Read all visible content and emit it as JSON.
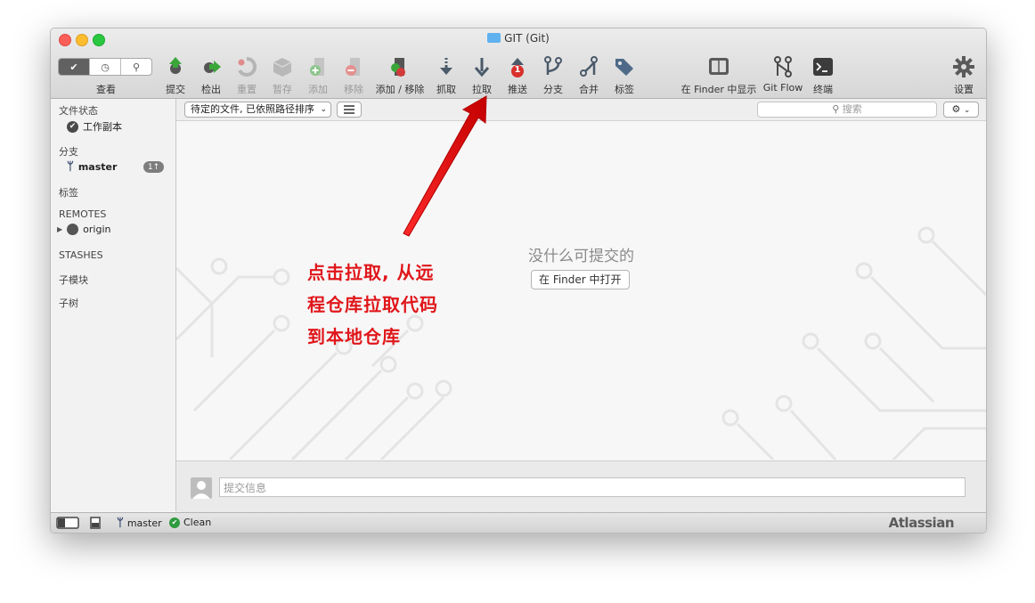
{
  "window": {
    "title": "GIT (Git)"
  },
  "view_label": "查看",
  "toolbar": {
    "commit": "提交",
    "checkout": "检出",
    "reset": "重置",
    "stash": "暂存",
    "add": "添加",
    "remove": "移除",
    "add_remove": "添加 / 移除",
    "fetch": "抓取",
    "pull": "拉取",
    "push": "推送",
    "branch": "分支",
    "merge": "合并",
    "tag": "标签",
    "show_in_finder": "在 Finder 中显示",
    "git_flow": "Git Flow",
    "terminal": "终端",
    "settings": "设置",
    "push_badge": "1"
  },
  "sidebar": {
    "file_status": "文件状态",
    "working_copy": "工作副本",
    "branches": "分支",
    "master": "master",
    "master_badge": "1↑",
    "tags": "标签",
    "remotes": "REMOTES",
    "origin": "origin",
    "stashes": "STASHES",
    "submodules": "子模块",
    "subtrees": "子树"
  },
  "filter": {
    "sort": "待定的文件, 已依照路径排序",
    "search_placeholder": "搜索"
  },
  "main": {
    "empty_message": "没什么可提交的",
    "open_in_finder": "在 Finder 中打开"
  },
  "commit": {
    "placeholder": "提交信息"
  },
  "statusbar": {
    "branch": "master",
    "state": "Clean",
    "brand": "Atlassian"
  },
  "annotation": {
    "text": "点击拉取, 从远程仓库拉取代码到本地仓库",
    "color": "#e0161a"
  }
}
